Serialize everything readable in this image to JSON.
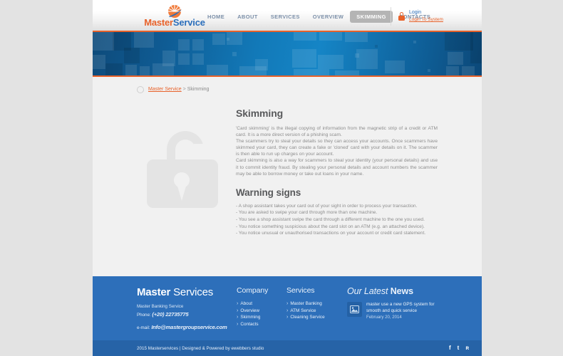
{
  "header": {
    "logo": {
      "part1": "Master",
      "part2": "Service",
      "icon": "sunburst-logo-icon"
    },
    "nav": [
      {
        "label": "HOME",
        "active": false
      },
      {
        "label": "ABOUT",
        "active": false
      },
      {
        "label": "SERVICES",
        "active": false
      },
      {
        "label": "OVERVIEW",
        "active": false
      },
      {
        "label": "SKIMMING",
        "active": true
      },
      {
        "label": "CONTACTS",
        "active": false
      }
    ],
    "login": {
      "icon": "lock-icon",
      "primary": "Login",
      "secondary": "Login To System"
    }
  },
  "breadcrumb": {
    "home": "Master Service",
    "separator": ">",
    "current": "Skimming"
  },
  "main": {
    "image_alt": "open-padlock-illustration",
    "title": "Skimming",
    "paragraphs": [
      "'Card skimming' is the illegal copying of information from the magnetic strip of a credit or ATM card. It is a more direct version of a phishing scam.",
      "The scammers try to steal your details so they can access your accounts. Once scammers have skimmed your card, they can create a fake or 'cloned' card with your details on it. The scammer is then able to run up charges on your account.",
      "Card skimming is also a way for scammers to steal your identity (your personal details) and use it to commit identity fraud. By stealing your personal details and account numbers the scammer may be able to borrow money or take out loans in your name."
    ],
    "warning_title": "Warning signs",
    "warnings": [
      "- A shop assistant takes your card out of your sight in order to process your transaction.",
      "- You are asked to swipe your card through more than one machine.",
      "- You see a shop assistant swipe the card through a different machine to the one you used.",
      "- You notice something suspicious about the card slot on an ATM (e.g. an attached device).",
      "- You notice unusual or unauthorised transactions on your account or credit card statement."
    ]
  },
  "footer": {
    "brand": {
      "bold": "Master",
      "light": "Services"
    },
    "tagline": "Master Banking Service",
    "phone_label": "Phone:",
    "phone_value": "(+20) 22735775",
    "email_label": "e-mail:",
    "email_value": "Info@mastergroupservice.com",
    "company": {
      "title": "Company",
      "links": [
        "About",
        "Overview",
        "Skimming",
        "Contacts"
      ]
    },
    "services": {
      "title": "Services",
      "links": [
        "Master Banking",
        "ATM Service",
        "Cleaning Service"
      ]
    },
    "news": {
      "title_italic": "Our Latest",
      "title_bold": "News",
      "thumb_icon": "image-placeholder-icon",
      "headline": "master use a new GPS system for smooth and quick service",
      "date": "February 20, 2014"
    },
    "bottom": {
      "copyright": "2015 Masterservices | Designed & Powered by ewebbers studio",
      "social": [
        {
          "name": "facebook-icon",
          "glyph": "f"
        },
        {
          "name": "twitter-icon",
          "glyph": "t"
        },
        {
          "name": "rss-icon",
          "glyph": "ʀ"
        }
      ]
    }
  },
  "colors": {
    "accent_orange": "#e8622a",
    "brand_blue": "#2a6ebb",
    "footer_blue": "#2d6fba",
    "page_bg": "#e3e3e3",
    "content_bg": "#f1f1f1"
  }
}
